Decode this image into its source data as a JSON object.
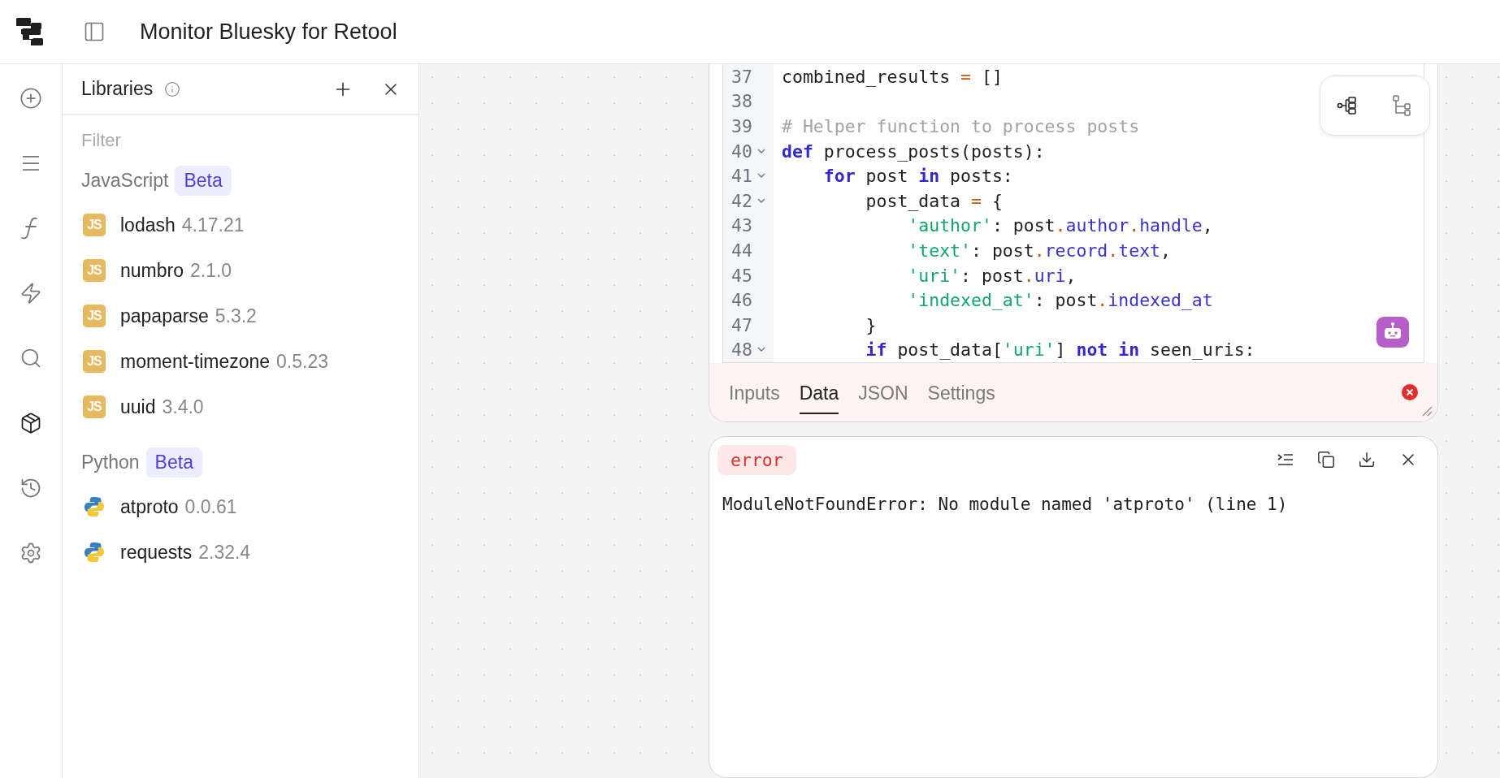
{
  "app": {
    "title": "Monitor Bluesky for Retool"
  },
  "rail": [
    {
      "kind": "add",
      "selected": false
    },
    {
      "kind": "components",
      "selected": false
    },
    {
      "kind": "functions",
      "selected": false
    },
    {
      "kind": "actions",
      "selected": false
    },
    {
      "kind": "search",
      "selected": false
    },
    {
      "kind": "libraries",
      "selected": true
    },
    {
      "kind": "history",
      "selected": false
    },
    {
      "kind": "settings",
      "selected": false
    }
  ],
  "libraries": {
    "title": "Libraries",
    "filter_placeholder": "Filter",
    "groups": [
      {
        "name": "JavaScript",
        "badge": "Beta",
        "items": [
          {
            "kind": "js",
            "icon_label": "JS",
            "name": "lodash",
            "version": "4.17.21"
          },
          {
            "kind": "js",
            "icon_label": "JS",
            "name": "numbro",
            "version": "2.1.0"
          },
          {
            "kind": "js",
            "icon_label": "JS",
            "name": "papaparse",
            "version": "5.3.2"
          },
          {
            "kind": "js",
            "icon_label": "JS",
            "name": "moment-timezone",
            "version": "0.5.23"
          },
          {
            "kind": "js",
            "icon_label": "JS",
            "name": "uuid",
            "version": "3.4.0"
          }
        ]
      },
      {
        "name": "Python",
        "badge": "Beta",
        "items": [
          {
            "kind": "python",
            "name": "atproto",
            "version": "0.0.61"
          },
          {
            "kind": "python",
            "name": "requests",
            "version": "2.32.4"
          }
        ]
      }
    ]
  },
  "editor": {
    "lines": [
      {
        "number": "37",
        "foldable": false,
        "tokens": [
          {
            "kind": "plain",
            "text": "combined_results "
          },
          {
            "kind": "op",
            "text": "="
          },
          {
            "kind": "plain",
            "text": " []"
          }
        ]
      },
      {
        "number": "38",
        "foldable": false
      },
      {
        "number": "39",
        "foldable": false,
        "tokens": [
          {
            "kind": "comment",
            "text": "# Helper function to process posts"
          }
        ]
      },
      {
        "number": "40",
        "foldable": true,
        "tokens": [
          {
            "kind": "keyword",
            "text": "def"
          },
          {
            "kind": "plain",
            "text": " process_posts(posts):"
          }
        ]
      },
      {
        "number": "41",
        "foldable": true,
        "tokens": [
          {
            "kind": "keyword",
            "text": "    for"
          },
          {
            "kind": "plain",
            "text": " post "
          },
          {
            "kind": "keyword",
            "text": "in"
          },
          {
            "kind": "plain",
            "text": " posts:"
          }
        ]
      },
      {
        "number": "42",
        "foldable": true,
        "tokens": [
          {
            "kind": "plain",
            "text": "        post_data "
          },
          {
            "kind": "op",
            "text": "="
          },
          {
            "kind": "plain",
            "text": " {"
          }
        ]
      },
      {
        "number": "43",
        "foldable": false,
        "tokens": [
          {
            "kind": "string",
            "text": "            'author'"
          },
          {
            "kind": "plain",
            "text": ": post"
          },
          {
            "kind": "op",
            "text": "."
          },
          {
            "kind": "attr",
            "text": "author"
          },
          {
            "kind": "op",
            "text": "."
          },
          {
            "kind": "attr",
            "text": "handle"
          },
          {
            "kind": "plain",
            "text": ","
          }
        ]
      },
      {
        "number": "44",
        "foldable": false,
        "tokens": [
          {
            "kind": "string",
            "text": "            'text'"
          },
          {
            "kind": "plain",
            "text": ": post"
          },
          {
            "kind": "op",
            "text": "."
          },
          {
            "kind": "attr",
            "text": "record"
          },
          {
            "kind": "op",
            "text": "."
          },
          {
            "kind": "attr",
            "text": "text"
          },
          {
            "kind": "plain",
            "text": ","
          }
        ]
      },
      {
        "number": "45",
        "foldable": false,
        "tokens": [
          {
            "kind": "string",
            "text": "            'uri'"
          },
          {
            "kind": "plain",
            "text": ": post"
          },
          {
            "kind": "op",
            "text": "."
          },
          {
            "kind": "attr",
            "text": "uri"
          },
          {
            "kind": "plain",
            "text": ","
          }
        ]
      },
      {
        "number": "46",
        "foldable": false,
        "tokens": [
          {
            "kind": "string",
            "text": "            'indexed_at'"
          },
          {
            "kind": "plain",
            "text": ": post"
          },
          {
            "kind": "op",
            "text": "."
          },
          {
            "kind": "attr",
            "text": "indexed_at"
          }
        ]
      },
      {
        "number": "47",
        "foldable": false,
        "tokens": [
          {
            "kind": "plain",
            "text": "        }"
          }
        ]
      },
      {
        "number": "48",
        "foldable": true,
        "tokens": [
          {
            "kind": "keyword",
            "text": "        if"
          },
          {
            "kind": "plain",
            "text": " post_data["
          },
          {
            "kind": "string",
            "text": "'uri'"
          },
          {
            "kind": "plain",
            "text": "] "
          },
          {
            "kind": "keyword",
            "text": "not"
          },
          {
            "kind": "keyword",
            "text": " in"
          },
          {
            "kind": "plain",
            "text": " seen_uris:"
          }
        ]
      }
    ],
    "tabs": [
      {
        "label": "Inputs",
        "selected": false
      },
      {
        "label": "Data",
        "selected": true
      },
      {
        "label": "JSON",
        "selected": false
      },
      {
        "label": "Settings",
        "selected": false
      }
    ],
    "has_error": true
  },
  "output": {
    "status": "error",
    "message": "ModuleNotFoundError: No module named 'atproto' (line 1)"
  }
}
